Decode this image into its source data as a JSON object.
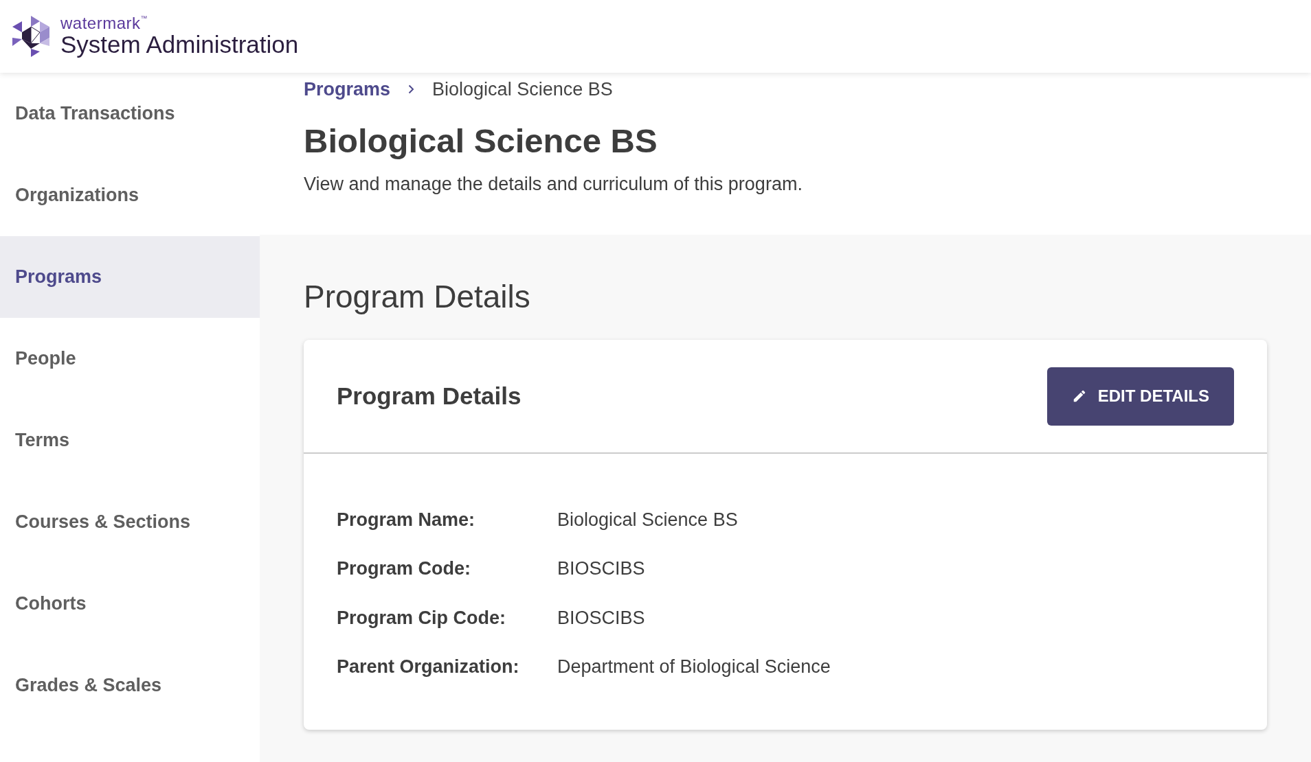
{
  "header": {
    "brand": "watermark",
    "trademark": "™",
    "title": "System Administration"
  },
  "sidebar": {
    "items": [
      {
        "label": "Data Transactions",
        "selected": false
      },
      {
        "label": "Organizations",
        "selected": false
      },
      {
        "label": "Programs",
        "selected": true
      },
      {
        "label": "People",
        "selected": false
      },
      {
        "label": "Terms",
        "selected": false
      },
      {
        "label": "Courses & Sections",
        "selected": false
      },
      {
        "label": "Cohorts",
        "selected": false
      },
      {
        "label": "Grades & Scales",
        "selected": false
      }
    ]
  },
  "breadcrumb": [
    {
      "label": "Programs",
      "kind": "link"
    },
    {
      "label": "Biological Science BS",
      "kind": "current"
    }
  ],
  "page": {
    "title": "Biological Science BS",
    "subtitle": "View and manage the details and curriculum of this program."
  },
  "section_title": "Program Details",
  "card": {
    "title": "Program Details",
    "button": "EDIT DETAILS",
    "fields": [
      {
        "label": "Program Name:",
        "value": "Biological Science BS"
      },
      {
        "label": "Program Code:",
        "value": "BIOSCIBS"
      },
      {
        "label": "Program Cip Code:",
        "value": "BIOSCIBS"
      },
      {
        "label": "Parent Organization:",
        "value": "Department of Biological Science"
      }
    ]
  }
}
